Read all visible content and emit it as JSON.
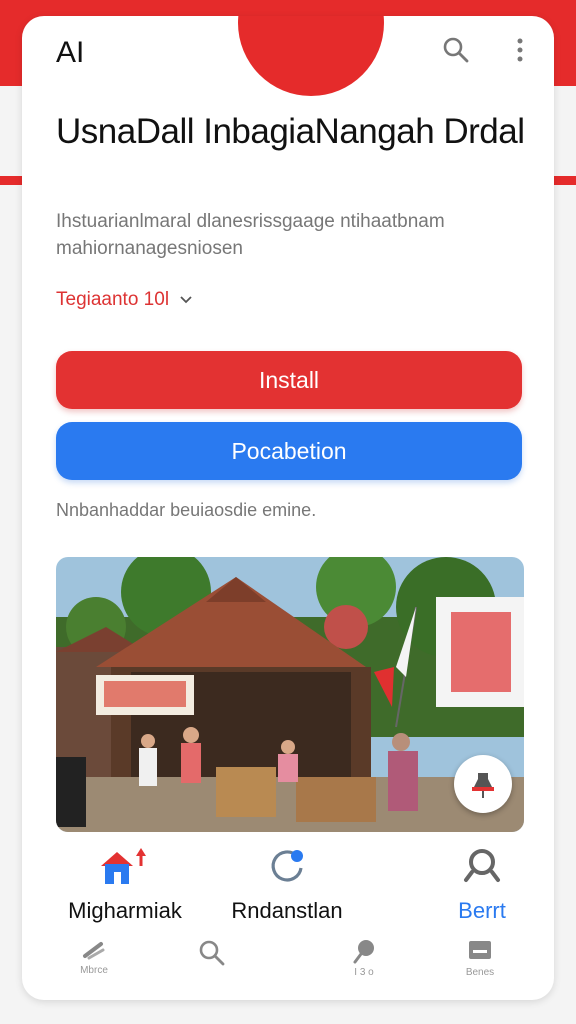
{
  "app": {
    "logo": "AI",
    "title": "UsnaDall InbagiaNangah Drdal",
    "description": "Ihstuarianlmaral dlanesrissgaage ntihaatbnam mahiornanagesniosen",
    "rating": "Tegiaanto 10l",
    "note": "Nnbanhaddar beuiaosdie emine."
  },
  "buttons": {
    "install": "Install",
    "secondary": "Pocabetion"
  },
  "nav": {
    "items": [
      {
        "label": "Migharmiak",
        "icon": "home-icon"
      },
      {
        "label": "Rndanstlan",
        "icon": "refresh-icon"
      },
      {
        "label": "Berrt",
        "icon": "search-person-icon"
      }
    ]
  },
  "subnav": {
    "items": [
      {
        "label": "Mbrce",
        "icon": "pencil-icon"
      },
      {
        "label": "",
        "icon": "search-icon"
      },
      {
        "label": "I 3 o",
        "icon": "chat-icon"
      },
      {
        "label": "Benes",
        "icon": "box-icon"
      }
    ]
  },
  "colors": {
    "brand_red": "#e52b2b",
    "install_red": "#e33232",
    "accent_blue": "#2a7af0"
  }
}
